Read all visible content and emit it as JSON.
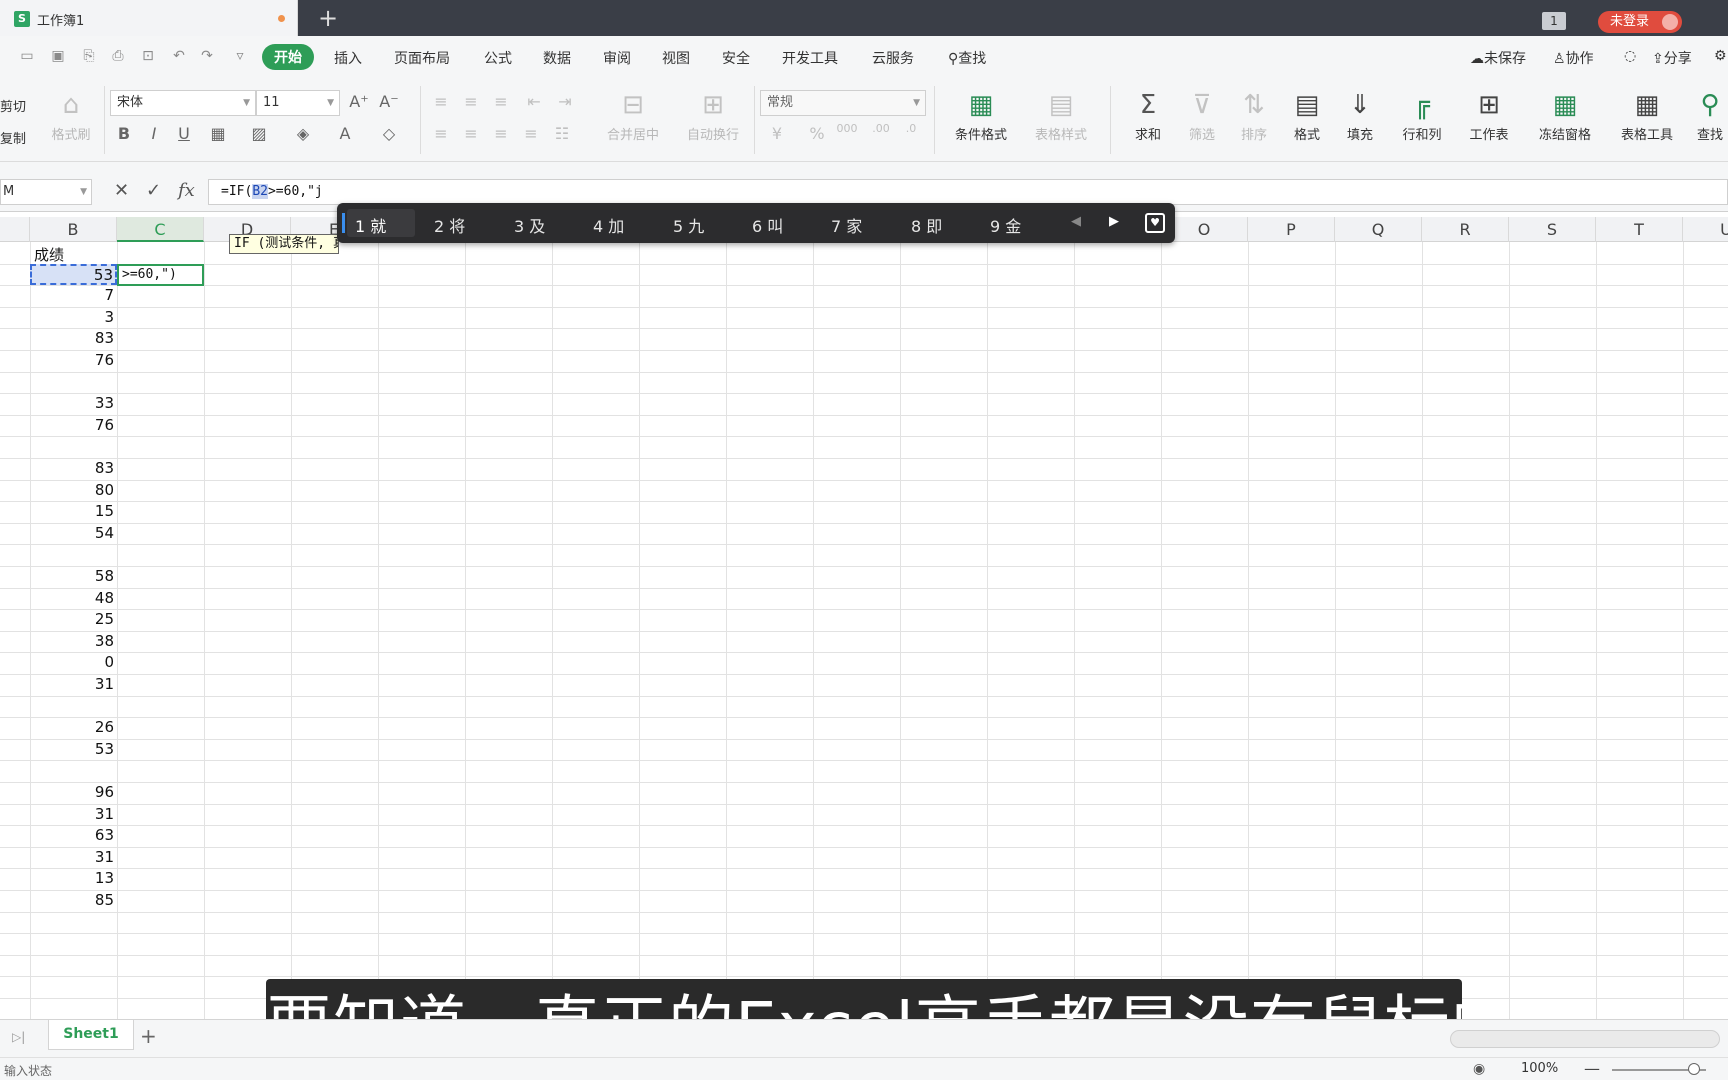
{
  "titlebar": {
    "doc_title": "工作簿1",
    "window_count": "1",
    "login_label": "未登录"
  },
  "menu": {
    "items": [
      "开始",
      "插入",
      "页面布局",
      "公式",
      "数据",
      "审阅",
      "视图",
      "安全",
      "开发工具",
      "云服务"
    ],
    "search_label": "查找",
    "right": {
      "unsaved": "未保存",
      "collab": "协作",
      "share": "分享"
    }
  },
  "ribbon": {
    "cut": "剪切",
    "copy": "复制",
    "format_painter": "格式刷",
    "font_name": "宋体",
    "font_size": "11",
    "merge_center": "合并居中",
    "auto_wrap": "自动换行",
    "number_format": "常规",
    "cond_format": "条件格式",
    "table_style": "表格样式",
    "sum": "求和",
    "filter": "筛选",
    "sort": "排序",
    "format": "格式",
    "fill": "填充",
    "row_col": "行和列",
    "worksheet": "工作表",
    "freeze": "冻结窗格",
    "table_tools": "表格工具",
    "find": "查找"
  },
  "formula_bar": {
    "name_box": "M",
    "fx": "fx",
    "formula_pre": "=IF(",
    "formula_ref": "B2",
    "formula_post": ">=60,\"j"
  },
  "sheet": {
    "columns": [
      "B",
      "C",
      "D",
      "E",
      "F",
      "G",
      "H",
      "I",
      "J",
      "K",
      "L",
      "M",
      "N",
      "O",
      "P",
      "Q",
      "R",
      "S",
      "T",
      "U"
    ],
    "header_text": "成绩",
    "active_value": "53",
    "editing_text": ">=60,\")",
    "tooltip": "IF (测试条件, 真值, [假值])",
    "b_values": [
      "7",
      "3",
      "83",
      "76",
      "",
      "33",
      "76",
      "",
      "83",
      "80",
      "15",
      "54",
      "",
      "58",
      "48",
      "25",
      "38",
      "0",
      "31",
      "",
      "26",
      "53",
      "",
      "96",
      "31",
      "63",
      "31",
      "13",
      "85"
    ]
  },
  "ime": {
    "candidates": [
      "1 就",
      "2 将",
      "3 及",
      "4 加",
      "5 九",
      "6 叫",
      "7 家",
      "8 即",
      "9 金"
    ]
  },
  "tabs": {
    "sheet_name": "Sheet1"
  },
  "status": {
    "text": "输入状态",
    "zoom": "100%"
  },
  "subtitle": "要知道，真正的Excel高手都是没有鼠标的"
}
